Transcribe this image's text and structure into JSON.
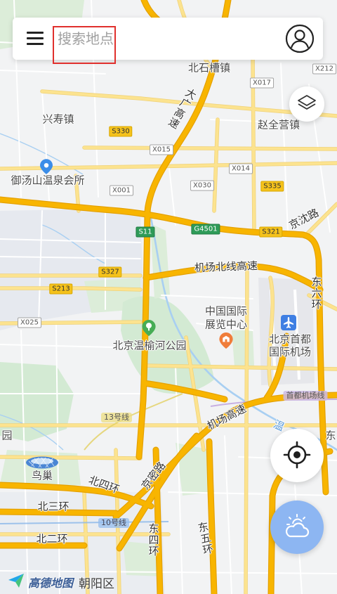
{
  "search_bar": {
    "placeholder": "搜索地点",
    "menu_icon": "menu-icon",
    "user_icon": "user-icon"
  },
  "controls": {
    "layers_icon": "layers-icon",
    "locate_icon": "locate-icon",
    "weather_icon": "weather-icon"
  },
  "map": {
    "places": {
      "beishicao": "北石槽镇",
      "xingshou": "兴寿镇",
      "zhaoquanying": "赵全营镇",
      "yutangshan": "御汤山温泉会所",
      "expo_line1": "中国国际",
      "expo_line2": "展览中心",
      "airport_line1": "北京首都",
      "airport_line2": "国际机场",
      "wenyuhe_park": "北京温榆河公园",
      "niaochao": "鸟巢",
      "edge_left": "园",
      "edge_right": "东",
      "river": "温"
    },
    "roads": {
      "daguang": "大广高速",
      "jingshen": "京沈路",
      "airport_north_line": "机场北线高速",
      "east_6th_ring": "东六环",
      "airport_expressway": "机场高速",
      "jingmi": "京密路",
      "north_4th_ring": "北四环",
      "north_3rd_ring": "北三环",
      "north_2nd_ring": "北二环",
      "east_4th_ring": "东四环",
      "east_5th_ring": "东五环"
    },
    "shields": {
      "x212": "X212",
      "x017": "X017",
      "s330": "S330",
      "x015": "X015",
      "x014": "X014",
      "x030": "X030",
      "s335": "S335",
      "x001": "X001",
      "s11": "S11",
      "g4501": "G4501",
      "s321": "S321",
      "s327": "S327",
      "s213": "S213",
      "x025": "X025"
    },
    "metro": {
      "line13": "13号线",
      "line10": "10号线",
      "airport_express": "首都机场线"
    },
    "poi_icons": {
      "hot_spring": "location-pin-icon",
      "park": "park-pin-icon",
      "expo": "expo-pin-icon",
      "airport": "airport-icon",
      "stadium": "birds-nest-icon"
    }
  },
  "footer": {
    "brand": "高德地图",
    "district": "朝阳区",
    "logo_icon": "amap-logo-icon"
  },
  "colors": {
    "map_background": "#f2f3f4",
    "highway": "#f8b500",
    "highway_edge": "#e5a100",
    "secondary_road": "#fce38f",
    "water": "#a8cff2",
    "park": "#d3ead3",
    "weather_button": "#8db6f2",
    "highlight_box": "#e0302d",
    "pin_blue": "#3b8de8",
    "pin_green": "#46ad55",
    "pin_orange": "#f07d3a",
    "shield_green": "#2e9b58",
    "shield_yellow": "#f5c21b"
  }
}
